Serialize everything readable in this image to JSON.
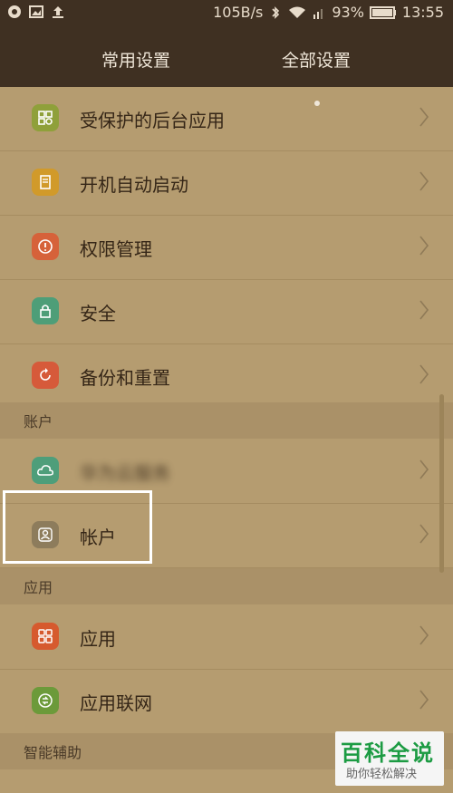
{
  "status_bar": {
    "speed": "105B/s",
    "battery": "93%",
    "time": "13:55",
    "icons": [
      "notification-icon",
      "image-icon",
      "upload-icon",
      "bluetooth-icon",
      "wifi-icon",
      "signal-icon",
      "battery-icon"
    ]
  },
  "tabs": {
    "common": "常用设置",
    "all": "全部设置"
  },
  "rows": [
    {
      "label": "受保护的后台应用",
      "icon": "protected-apps-icon",
      "color": "#8fa03a"
    },
    {
      "label": "开机自动启动",
      "icon": "autostart-icon",
      "color": "#d19a2a"
    },
    {
      "label": "权限管理",
      "icon": "permission-icon",
      "color": "#d6623a"
    },
    {
      "label": "安全",
      "icon": "lock-icon",
      "color": "#4e9e78"
    },
    {
      "label": "备份和重置",
      "icon": "backup-icon",
      "color": "#d65a3a"
    }
  ],
  "section_account": "账户",
  "account_rows": [
    {
      "label": "华为云服务",
      "icon": "cloud-icon",
      "color": "#4e9e7a"
    },
    {
      "label": "帐户",
      "icon": "user-icon",
      "color": "#8d7c5c"
    }
  ],
  "section_apps": "应用",
  "app_rows": [
    {
      "label": "应用",
      "icon": "apps-icon",
      "color": "#d65a2e"
    },
    {
      "label": "应用联网",
      "icon": "network-icon",
      "color": "#6c9a3a"
    }
  ],
  "section_assist": "智能辅助",
  "watermark": {
    "title": "百科全说",
    "subtitle": "助你轻松解决"
  }
}
